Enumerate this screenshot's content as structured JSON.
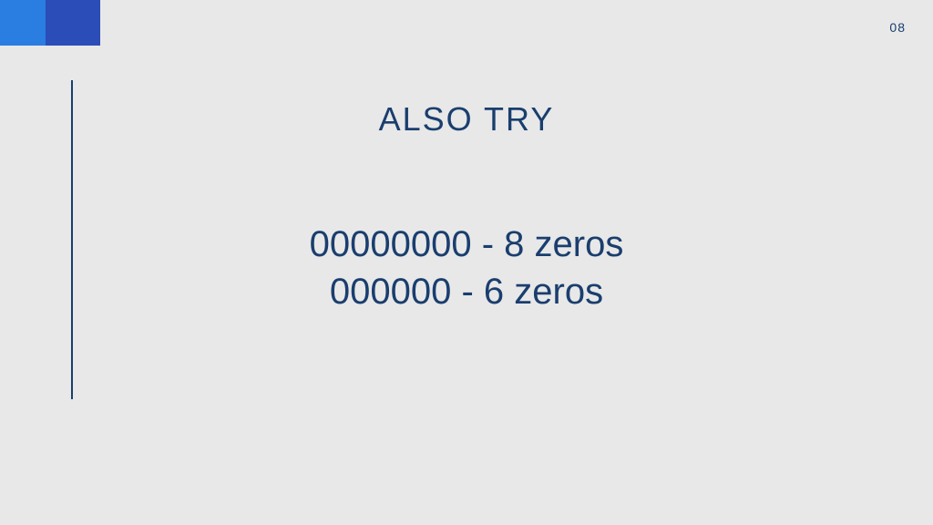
{
  "page_number": "08",
  "title": "ALSO TRY",
  "lines": {
    "line1": "00000000 - 8 zeros",
    "line2": "000000 - 6 zeros"
  },
  "colors": {
    "text": "#1a3e6e",
    "block_light": "#2a7de1",
    "block_dark": "#2a4db8",
    "background": "#e8e8e8"
  }
}
